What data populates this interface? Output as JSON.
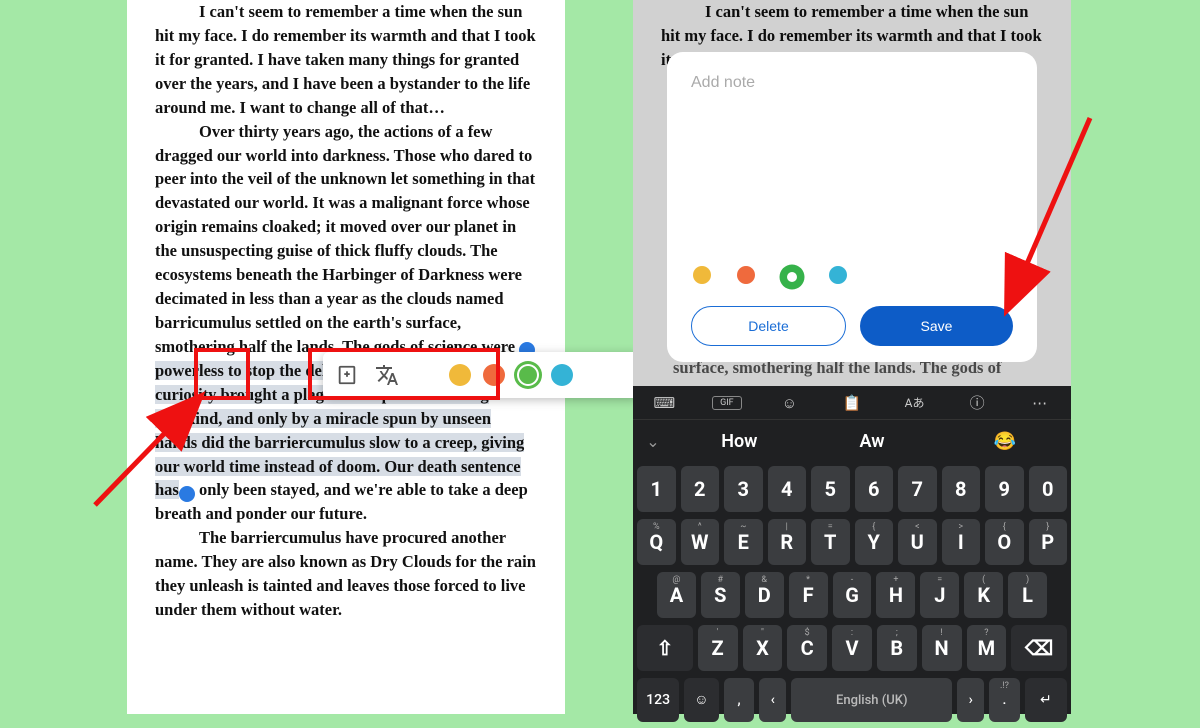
{
  "reader": {
    "p1": "I can't seem to remember a time when the sun hit my face. I do remember its warmth and that I took it for granted. I have taken many things for granted over the years, and I have been a bystander to the life around me. I want to change all of that…",
    "p2a": "Over thirty years ago, the actions of a few dragged our world into darkness. Those who dared to peer into the veil of the unknown let something in that devastated our world. It was a malignant force whose origin remains cloaked; it moved over our planet in the unsuspecting guise of thick fluffy clouds. The ecosystems beneath the Harbinger of Darkness were decimated in less than a year as the clouds named barricumulus settled on the earth's surface, smothering half the lands. The gods of science were ",
    "p2b_hl": "powerless to stop the deluge they opened. Their curiosity brought a plague and spread it among mankind, and only by a miracle spun by unseen hands did the barriercumulus slow to a creep, giving our world time instead of doom. Our death sentence has",
    "p2c": " only been stayed, and we're able to take a deep breath and ponder our future.",
    "p3": "The barriercumulus have procured another name. They are also known as Dry Clouds for the rain they unleash is tainted and leaves those forced to live under them without water."
  },
  "reader_right": {
    "p1": "I can't seem to remember a time when the sun hit my face. I do remember its warmth and that I took it for granted. I have taken many",
    "peek1": "surface, smothering half the lands. The gods of"
  },
  "toolbar": {
    "colors": {
      "yellow": "#f0b93a",
      "orange": "#ef6a3d",
      "green": "#59bb4a",
      "blue": "#34b3d6"
    }
  },
  "note": {
    "placeholder": "Add note",
    "delete_label": "Delete",
    "save_label": "Save"
  },
  "keyboard": {
    "suggest1": "How",
    "suggest2": "Aw",
    "suggest3": "😂",
    "row1": [
      "1",
      "2",
      "3",
      "4",
      "5",
      "6",
      "7",
      "8",
      "9",
      "0"
    ],
    "row2": {
      "alts": [
        "%",
        "^",
        "~",
        "|",
        "=",
        "{",
        "<",
        ">",
        "{",
        "}"
      ],
      "main": [
        "Q",
        "W",
        "E",
        "R",
        "T",
        "Y",
        "U",
        "I",
        "O",
        "P"
      ]
    },
    "row3": {
      "alts": [
        "@",
        "#",
        "&",
        "*",
        "-",
        "+",
        "=",
        "(",
        ")"
      ],
      "main": [
        "A",
        "S",
        "D",
        "F",
        "G",
        "H",
        "J",
        "K",
        "L"
      ]
    },
    "row4": {
      "alts": [
        "",
        "'",
        "\"",
        "$",
        ":",
        ";",
        "!",
        "?"
      ],
      "main": [
        "Z",
        "X",
        "C",
        "V",
        "B",
        "N",
        "M"
      ]
    },
    "mode_label": "123",
    "space_label": "English (UK)",
    "comma": ",",
    "period_alt": ".!?"
  }
}
